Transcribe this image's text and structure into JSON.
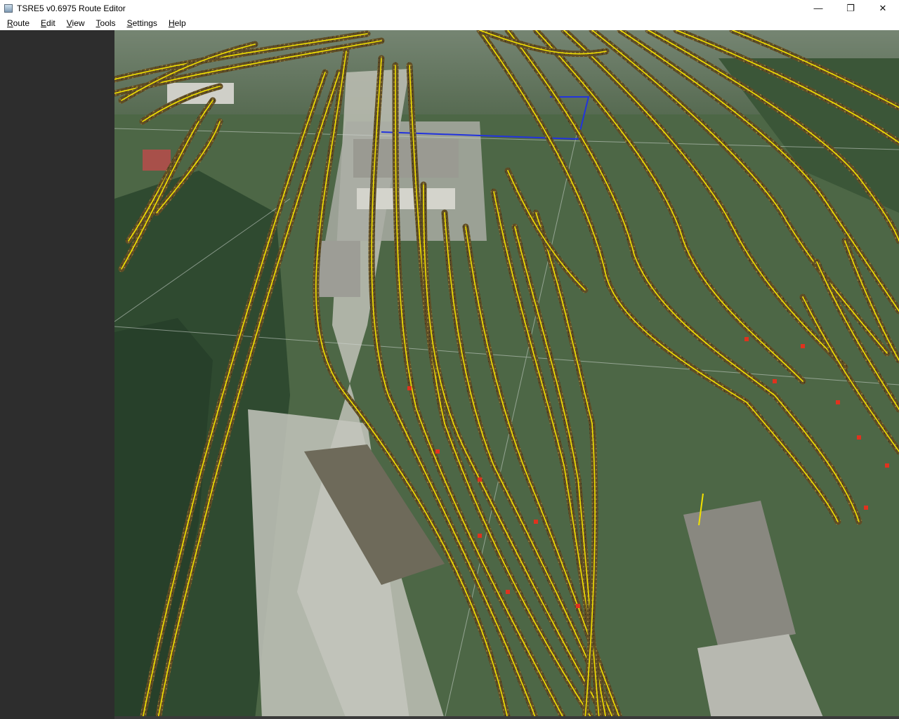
{
  "window": {
    "title": "TSRE5 v0.6975 Route Editor",
    "controls": {
      "minimize": "—",
      "restore": "❐",
      "close": "✕"
    }
  },
  "menu": [
    {
      "accel": "R",
      "rest": "oute"
    },
    {
      "accel": "E",
      "rest": "dit"
    },
    {
      "accel": "V",
      "rest": "iew"
    },
    {
      "accel": "T",
      "rest": "ools"
    },
    {
      "accel": "S",
      "rest": "ettings"
    },
    {
      "accel": "H",
      "rest": "elp"
    }
  ],
  "viewport": {
    "description_icon": "3d-viewport",
    "colors": {
      "track": "#f2e100",
      "ballast": "#6f5a2a",
      "blue_line": "#2233dd",
      "switch_marker": "#e0321e",
      "grass": "#4b6a3f",
      "forest": "#2f4a30",
      "gravel": "#b9bbb0",
      "roof": "#9a9a92"
    }
  }
}
